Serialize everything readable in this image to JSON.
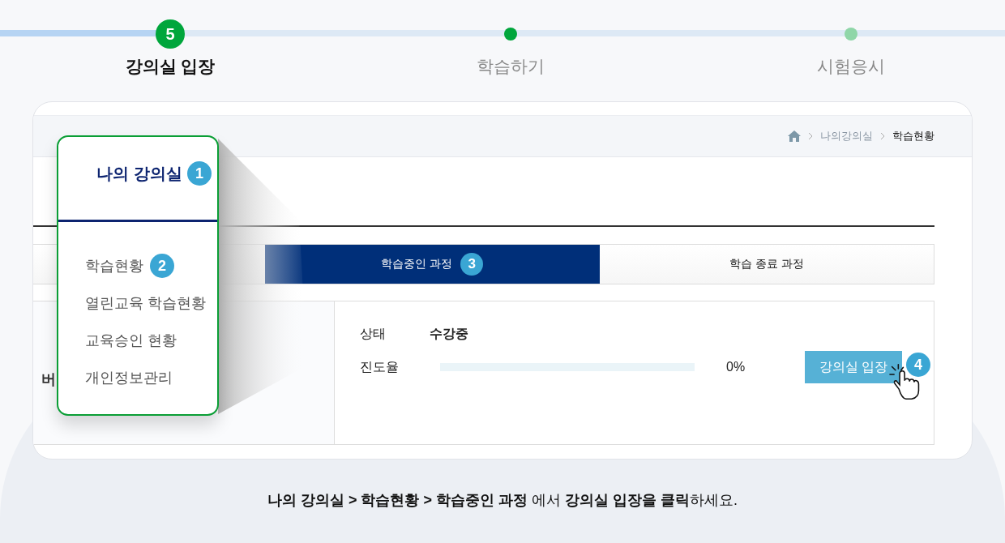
{
  "steps": [
    {
      "label": "강의실 입장",
      "number": "5",
      "selected": true,
      "color": "#00a63c"
    },
    {
      "label": "학습하기",
      "selected": false,
      "color": "#00a63c"
    },
    {
      "label": "시험응시",
      "selected": false,
      "color": "#8fd6a8"
    }
  ],
  "breadcrumb": [
    "나의강의실",
    "학습현황"
  ],
  "popup": {
    "title": "나의 강의실",
    "badge": "1",
    "items": [
      {
        "label": "학습현황",
        "badge": "2"
      },
      {
        "label": "열린교육 학습현황"
      },
      {
        "label": "교육승인 현황"
      },
      {
        "label": "개인정보관리"
      }
    ]
  },
  "tabs": [
    {
      "label": "학습중인 과정",
      "selected": true,
      "badge": "3"
    },
    {
      "label": "학습 종료 과정",
      "selected": false
    }
  ],
  "course": {
    "title_fragment": "버",
    "status_label": "상태",
    "status": "수강중",
    "progress_label": "진도율",
    "level": 0,
    "reading": "0%",
    "button": "강의실 입장",
    "badge": "4"
  },
  "instruction": "**나의 강의실 > 학습현황 > 학습중인 과정** 에서 **강의실 입장을 클릭**하세요."
}
